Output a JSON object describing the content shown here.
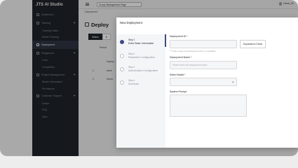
{
  "app": {
    "title": "JTS AI Studio",
    "project_select": "Group Management Page",
    "user": "Demo_00"
  },
  "sidebar": {
    "items": [
      {
        "label": "Dashboard",
        "type": "top"
      },
      {
        "label": "Training",
        "type": "group"
      },
      {
        "label": "Training Tasks",
        "type": "sub"
      },
      {
        "label": "Model Training",
        "type": "sub"
      },
      {
        "label": "Deployment",
        "type": "top",
        "active": true
      },
      {
        "label": "Playground",
        "type": "group"
      },
      {
        "label": "Chat",
        "type": "sub"
      },
      {
        "label": "Completion",
        "type": "sub"
      },
      {
        "label": "Project Management",
        "type": "group"
      },
      {
        "label": "Model Information",
        "type": "sub"
      },
      {
        "label": "Permission",
        "type": "sub"
      },
      {
        "label": "Customer Support",
        "type": "group"
      },
      {
        "label": "Notice",
        "type": "sub"
      },
      {
        "label": "FAQ",
        "type": "sub"
      },
      {
        "label": "Q&A",
        "type": "sub"
      }
    ]
  },
  "main": {
    "breadcrumb": "Deployment",
    "page_title": "Deploy",
    "tabs": [
      "Status",
      "D"
    ],
    "column_period": "Period",
    "column_deploy": "Deploy",
    "rows": [
      "1",
      "2"
    ],
    "row_labels": [
      "admi",
      "Demo"
    ]
  },
  "modal": {
    "title": "New Deployment",
    "close_label": "×",
    "steps": [
      {
        "num": "Step 1",
        "label": "Enter Basic Information",
        "active": true
      },
      {
        "num": "Step 2",
        "label": "Parameter Configuration",
        "active": false
      },
      {
        "num": "Step 3",
        "label": "Authorization Configuration",
        "active": false
      },
      {
        "num": "Step 4",
        "label": "Summary",
        "active": false
      }
    ],
    "fields": {
      "deployment_id_label": "Deployment ID *",
      "deployment_id_value": "",
      "duplication_check_label": "Duplication Check",
      "deployment_id_hint": "*** Enter unique and distinguished ID is not available",
      "deployment_name_label": "Deployment Name *",
      "deployment_name_placeholder": "Please enter the deployment name",
      "select_model_label": "Select Model *",
      "select_model_value": "",
      "system_prompt_label": "System Prompt"
    }
  }
}
